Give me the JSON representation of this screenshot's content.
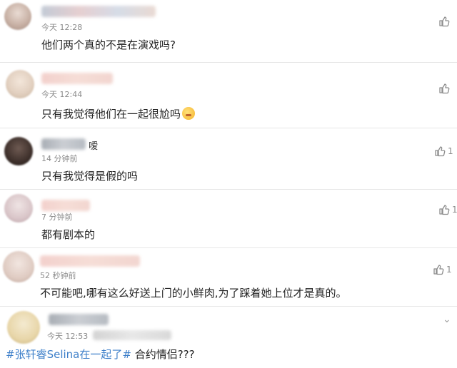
{
  "comments": [
    {
      "time": "今天 12:28",
      "text": "他们两个真的不是在演戏吗?",
      "likes": ""
    },
    {
      "time": "今天 12:44",
      "text": "只有我觉得他们在一起很尬吗",
      "likes": ""
    },
    {
      "name_suffix": "嗳",
      "time": "14 分钟前",
      "text": "只有我觉得是假的吗",
      "likes": "1"
    },
    {
      "time": "7 分钟前",
      "text": "都有剧本的",
      "likes": "1"
    },
    {
      "time": "52 秒钟前",
      "text": "不可能吧,哪有这么好送上门的小鲜肉,为了踩着她上位才是真的。",
      "likes": "1"
    },
    {
      "time": "今天 12:53",
      "hashtag": "#张轩睿Selina在一起了#",
      "text": " 合约情侣???",
      "likes": ""
    }
  ],
  "icons": {
    "like": "thumbs-up-icon",
    "emoji": "awkward-face-emoji",
    "expand": "chevron-down-icon"
  },
  "colors": {
    "hashtag": "#3d7fc9",
    "time": "#8a8a8a",
    "divider": "#e6e6e6"
  }
}
